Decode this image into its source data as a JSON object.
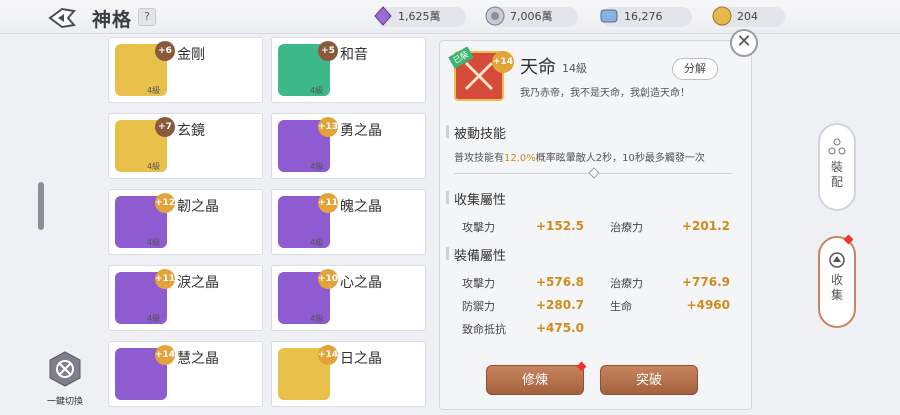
{
  "header": {
    "title": "神格",
    "help": "?"
  },
  "resources": [
    {
      "icon": "crystal-icon",
      "value": "1,625萬"
    },
    {
      "icon": "coin-icon",
      "value": "7,006萬"
    },
    {
      "icon": "stone-icon",
      "value": "16,276"
    },
    {
      "icon": "gold-icon",
      "value": "204"
    }
  ],
  "switch_label": "一鍵切換",
  "cards": [
    {
      "name": "金剛",
      "plus": "+6",
      "level": "4級",
      "color": "#e8c04a"
    },
    {
      "name": "和音",
      "plus": "+5",
      "level": "4級",
      "color": "#3db88a"
    },
    {
      "name": "玄鏡",
      "plus": "+7",
      "level": "4級",
      "color": "#e8c04a"
    },
    {
      "name": "勇之晶",
      "plus": "+13",
      "level": "4級",
      "color": "#8e5bd1"
    },
    {
      "name": "韌之晶",
      "plus": "+12",
      "level": "4級",
      "color": "#8e5bd1"
    },
    {
      "name": "魄之晶",
      "plus": "+11",
      "level": "4級",
      "color": "#8e5bd1"
    },
    {
      "name": "淚之晶",
      "plus": "+11",
      "level": "4級",
      "color": "#8e5bd1"
    },
    {
      "name": "心之晶",
      "plus": "+10",
      "level": "4級",
      "color": "#8e5bd1"
    },
    {
      "name": "慧之晶",
      "plus": "+14",
      "level": "",
      "color": "#8e5bd1"
    },
    {
      "name": "日之晶",
      "plus": "+14",
      "level": "",
      "color": "#e8c04a"
    }
  ],
  "detail": {
    "badge": "已裝",
    "plus": "+14",
    "name": "天命",
    "level": "14級",
    "quote": "我乃赤帝，我不是天命，我創造天命！",
    "split": "分解",
    "passive_title": "被動技能",
    "passive_pre": "普攻技能有",
    "passive_pct": "12.0%",
    "passive_post": "概率眩暈敵人2秒，10秒最多觸發一次",
    "collect_title": "收集屬性",
    "collect": [
      {
        "name": "攻擊力",
        "value": "+152.5"
      },
      {
        "name": "治療力",
        "value": "+201.2"
      }
    ],
    "equip_title": "裝備屬性",
    "equip": [
      {
        "name": "攻擊力",
        "value": "+576.8"
      },
      {
        "name": "治療力",
        "value": "+776.9"
      },
      {
        "name": "防禦力",
        "value": "+280.7"
      },
      {
        "name": "生命",
        "value": "+4960"
      },
      {
        "name": "致命抵抗",
        "value": "+475.0"
      }
    ],
    "train": "修煉",
    "breakthrough": "突破"
  },
  "side": {
    "equip": "裝\n配",
    "collect": "收\n集"
  }
}
